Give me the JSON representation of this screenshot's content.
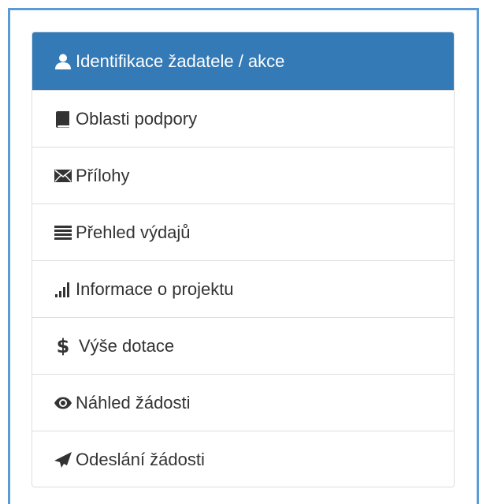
{
  "menu": {
    "items": [
      {
        "label": "Identifikace žadatele / akce",
        "icon": "user-icon",
        "active": true
      },
      {
        "label": "Oblasti podpory",
        "icon": "book-icon",
        "active": false
      },
      {
        "label": "Přílohy",
        "icon": "envelope-icon",
        "active": false
      },
      {
        "label": "Přehled výdajů",
        "icon": "list-icon",
        "active": false
      },
      {
        "label": "Informace o projektu",
        "icon": "signal-icon",
        "active": false
      },
      {
        "label": "Výše dotace",
        "icon": "dollar-icon",
        "active": false
      },
      {
        "label": "Náhled žádosti",
        "icon": "eye-icon",
        "active": false
      },
      {
        "label": "Odeslání žádosti",
        "icon": "send-icon",
        "active": false
      }
    ]
  },
  "colors": {
    "active_background": "#337ab7",
    "frame_border": "#5b9bd5",
    "item_border": "#dddddd",
    "text": "#333333"
  }
}
